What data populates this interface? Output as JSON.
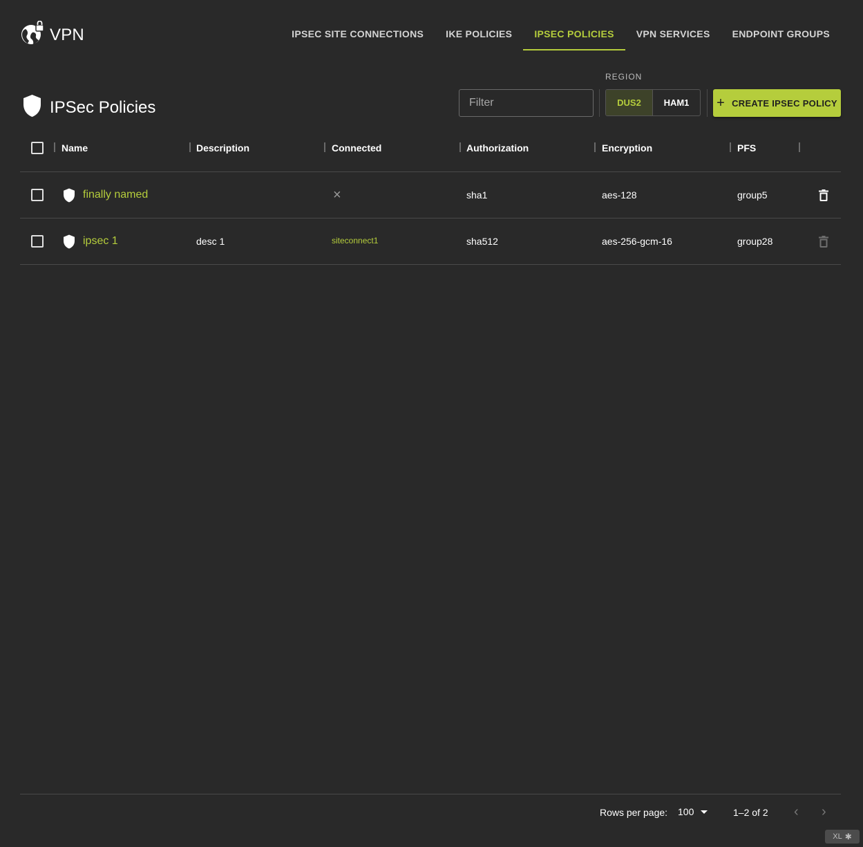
{
  "app": {
    "title": "VPN",
    "icon": "globe-lock-icon",
    "accent_color": "#b5cd3c",
    "background_color": "#292929"
  },
  "nav": {
    "tabs": [
      {
        "label": "IPSEC SITE CONNECTIONS",
        "active": false
      },
      {
        "label": "IKE POLICIES",
        "active": false
      },
      {
        "label": "IPSEC POLICIES",
        "active": true
      },
      {
        "label": "VPN SERVICES",
        "active": false
      },
      {
        "label": "ENDPOINT GROUPS",
        "active": false
      }
    ]
  },
  "page": {
    "title": "IPSec Policies",
    "icon": "shield-icon"
  },
  "toolbar": {
    "filter_placeholder": "Filter",
    "filter_value": "",
    "region_label": "REGION",
    "regions": [
      {
        "label": "DUS2",
        "active": true
      },
      {
        "label": "HAM1",
        "active": false
      }
    ],
    "create_label": "CREATE IPSEC POLICY",
    "create_icon": "plus-icon"
  },
  "table": {
    "columns": [
      "Name",
      "Description",
      "Connected",
      "Authorization",
      "Encryption",
      "PFS"
    ],
    "rows": [
      {
        "name": "finally named",
        "description": "",
        "connected": null,
        "connected_icon": "close-icon",
        "authorization": "sha1",
        "encryption": "aes-128",
        "pfs": "group5",
        "delete_enabled": true
      },
      {
        "name": "ipsec 1",
        "description": "desc 1",
        "connected": "siteconnect1",
        "connected_icon": null,
        "authorization": "sha512",
        "encryption": "aes-256-gcm-16",
        "pfs": "group28",
        "delete_enabled": false
      }
    ]
  },
  "footer": {
    "rows_per_page_label": "Rows per page:",
    "rows_per_page_value": "100",
    "range_text": "1–2 of 2"
  },
  "badge": {
    "text": "XL",
    "icon": "bug-icon"
  }
}
